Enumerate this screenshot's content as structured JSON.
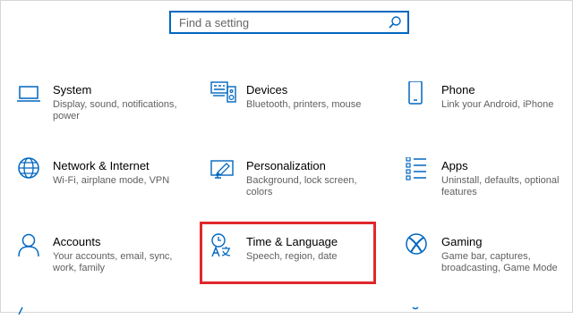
{
  "search": {
    "placeholder": "Find a setting",
    "icon": "search-icon"
  },
  "accent_color": "#0067c0",
  "highlight_color": "#e0282b",
  "tiles": [
    {
      "title": "System",
      "desc": "Display, sound, notifications, power",
      "icon": "laptop-icon"
    },
    {
      "title": "Devices",
      "desc": "Bluetooth, printers, mouse",
      "icon": "devices-icon"
    },
    {
      "title": "Phone",
      "desc": "Link your Android, iPhone",
      "icon": "phone-icon"
    },
    {
      "title": "Network & Internet",
      "desc": "Wi-Fi, airplane mode, VPN",
      "icon": "globe-icon"
    },
    {
      "title": "Personalization",
      "desc": "Background, lock screen, colors",
      "icon": "personalization-icon"
    },
    {
      "title": "Apps",
      "desc": "Uninstall, defaults, optional features",
      "icon": "apps-list-icon"
    },
    {
      "title": "Accounts",
      "desc": "Your accounts, email, sync, work, family",
      "icon": "person-icon"
    },
    {
      "title": "Time & Language",
      "desc": "Speech, region, date",
      "icon": "time-language-icon"
    },
    {
      "title": "Gaming",
      "desc": "Game bar, captures, broadcasting, Game Mode",
      "icon": "xbox-icon"
    }
  ]
}
